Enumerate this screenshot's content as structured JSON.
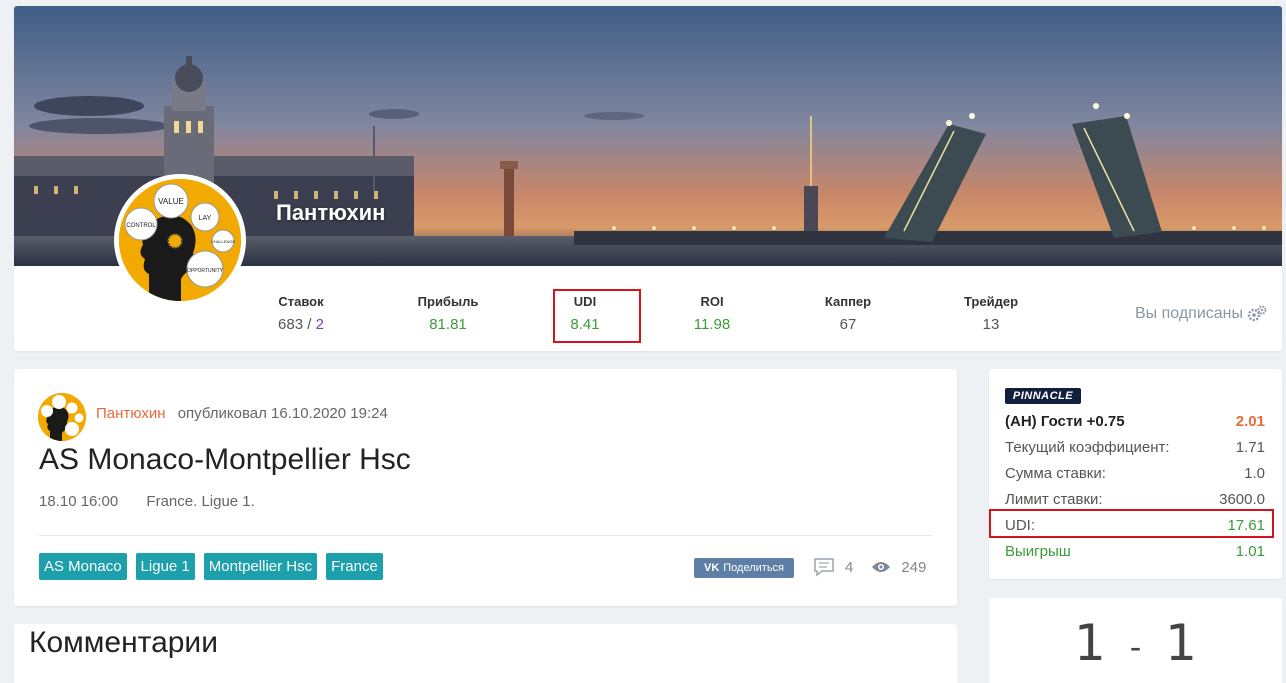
{
  "profile": {
    "name": "Пантюхин",
    "stats": [
      {
        "label": "Ставок",
        "value": "683",
        "value_extra": "2"
      },
      {
        "label": "Прибыль",
        "value": "81.81"
      },
      {
        "label": "UDI",
        "value": "8.41"
      },
      {
        "label": "ROI",
        "value": "11.98"
      },
      {
        "label": "Каппер",
        "value": "67"
      },
      {
        "label": "Трейдер",
        "value": "13"
      }
    ],
    "subscribed_label": "Вы подписаны",
    "avatar_words": [
      "VALUE",
      "CONTROL",
      "LAY",
      "CHALLENGE",
      "OPPORTUNITY"
    ]
  },
  "post": {
    "author": "Пантюхин",
    "published_text": "опубликовал 16.10.2020 19:24",
    "title": "AS Monaco-Montpellier Hsc",
    "date": "18.10 16:00",
    "league": "France. Ligue 1.",
    "tags": [
      "AS Monaco",
      "Ligue 1",
      "Montpellier Hsc",
      "France"
    ],
    "share_label": "Поделиться",
    "share_icon": "VK",
    "comments_count": "4",
    "views_count": "249"
  },
  "comments": {
    "title": "Комментарии"
  },
  "bet": {
    "bookmaker": "PINNACLE",
    "selection": "(АН) Гости +0.75",
    "odds": "2.01",
    "rows": [
      {
        "label": "Текущий коэффициент:",
        "value": "1.71"
      },
      {
        "label": "Сумма ставки:",
        "value": "1.0"
      },
      {
        "label": "Лимит ставки:",
        "value": "3600.0"
      },
      {
        "label": "UDI:",
        "value": "17.61"
      },
      {
        "label": "Выигрыш",
        "value": "1.01"
      }
    ]
  },
  "score": {
    "home": "1",
    "separator": "-",
    "away": "1"
  },
  "colors": {
    "accent_green": "#3a9b3a",
    "accent_orange": "#e86a3a",
    "tag_teal": "#1ba0ac",
    "highlight_red": "#d3141c"
  }
}
